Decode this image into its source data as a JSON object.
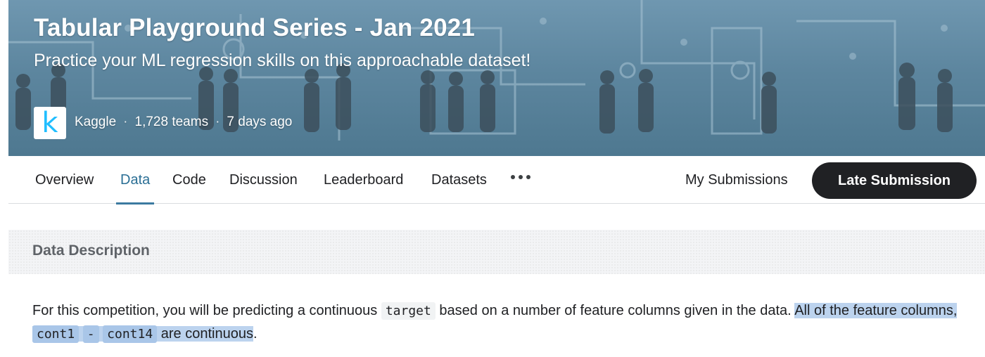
{
  "competition": {
    "title": "Tabular Playground Series - Jan 2021",
    "subtitle": "Practice your ML regression skills on this approachable dataset!",
    "logo_letter": "k",
    "organizer": "Kaggle",
    "teams": "1,728 teams",
    "age": "7 days ago",
    "separator": "·"
  },
  "tabs": [
    {
      "label": "Overview",
      "active": false
    },
    {
      "label": "Data",
      "active": true
    },
    {
      "label": "Code",
      "active": false
    },
    {
      "label": "Discussion",
      "active": false
    },
    {
      "label": "Leaderboard",
      "active": false
    },
    {
      "label": "Datasets",
      "active": false
    }
  ],
  "actions": {
    "more_icon": "more-horizontal-icon",
    "my_submissions": "My Submissions",
    "late_submission": "Late Submission"
  },
  "data_section": {
    "title": "Data Description",
    "text_1": "For this competition, you will be predicting a continuous ",
    "code_target": "target",
    "text_2": " based on a number of feature columns given in the data. ",
    "hl_text_1": "All of the feature columns, ",
    "code_cont1": "cont1",
    "code_dash": "-",
    "code_cont14": "cont14",
    "hl_text_2": " are continuous",
    "text_end": "."
  },
  "colors": {
    "banner": "#5d869f",
    "active_tab": "#2b6f95",
    "button": "#202124",
    "selection": "#bcd3ee"
  }
}
